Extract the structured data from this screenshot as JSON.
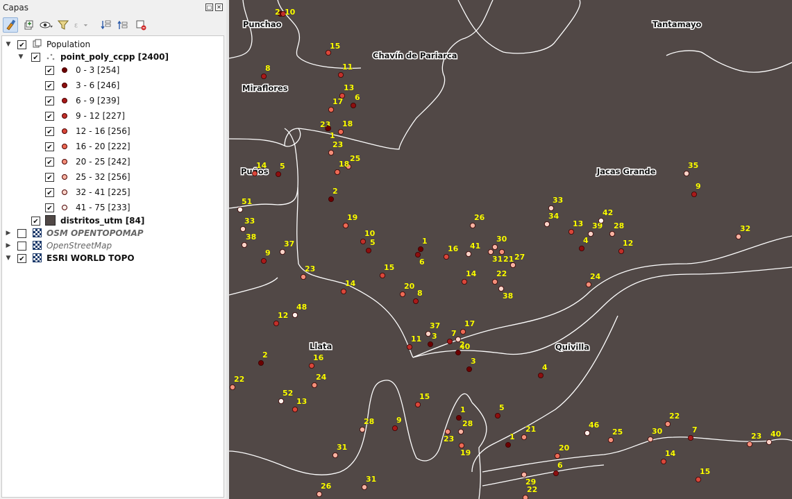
{
  "panel": {
    "title": "Capas",
    "toolbar_icons": [
      "style-manager-icon",
      "add-group-icon",
      "visibility-eye-icon",
      "filter-icon",
      "expression-filter-icon",
      "expand-all-icon",
      "collapse-all-icon",
      "remove-layer-icon"
    ]
  },
  "tree": {
    "group": {
      "label": "Population",
      "checked": true,
      "expanded": true
    },
    "points_layer": {
      "label": "point_poly_ccpp [2400]",
      "checked": true,
      "expanded": true
    },
    "classes": [
      {
        "label": "0 - 3 [254]",
        "color": "#6b0000"
      },
      {
        "label": "3 - 6 [246]",
        "color": "#8c0f0f"
      },
      {
        "label": "6 - 9 [239]",
        "color": "#a81a1a"
      },
      {
        "label": "9 - 12 [227]",
        "color": "#c0302a"
      },
      {
        "label": "12 - 16 [256]",
        "color": "#d9473a"
      },
      {
        "label": "16 - 20 [222]",
        "color": "#ec6a55"
      },
      {
        "label": "20 - 25 [242]",
        "color": "#f48f7a"
      },
      {
        "label": "25 - 32 [256]",
        "color": "#f8b3a2"
      },
      {
        "label": "32 - 41 [225]",
        "color": "#fbd3c8"
      },
      {
        "label": "41 - 75 [233]",
        "color": "#fff1ec"
      }
    ],
    "polygons_layer": {
      "label": "distritos_utm [84]",
      "checked": true,
      "color": "#514846"
    },
    "basemaps": [
      {
        "label": "OSM OPENTOPOMAP",
        "checked": false,
        "style": "italic"
      },
      {
        "label": "OpenStreetMap",
        "checked": false,
        "style": "italic"
      },
      {
        "label": "ESRI WORLD TOPO",
        "checked": true,
        "style": "bold"
      }
    ]
  },
  "map": {
    "district_labels": [
      "Punchao",
      "Tantamayo",
      "Chavín de Pariarca",
      "Miraflores",
      "Puños",
      "Jacas Grande",
      "Llata",
      "Quivilla"
    ],
    "points": [
      {
        "label": "2",
        "v": 2
      },
      {
        "label": "10",
        "v": 10
      },
      {
        "label": "15",
        "v": 15
      },
      {
        "label": "8",
        "v": 8
      },
      {
        "label": "11",
        "v": 11
      },
      {
        "label": "13",
        "v": 13
      },
      {
        "label": "6",
        "v": 6
      },
      {
        "label": "17",
        "v": 17
      },
      {
        "label": "23",
        "v": 23
      },
      {
        "label": "1",
        "v": 1
      },
      {
        "label": "18",
        "v": 18
      },
      {
        "label": "23",
        "v": 23
      },
      {
        "label": "25",
        "v": 25
      },
      {
        "label": "18",
        "v": 18
      },
      {
        "label": "14",
        "v": 14
      },
      {
        "label": "5",
        "v": 5
      },
      {
        "label": "2",
        "v": 2
      },
      {
        "label": "51",
        "v": 51
      },
      {
        "label": "33",
        "v": 33
      },
      {
        "label": "38",
        "v": 38
      },
      {
        "label": "9",
        "v": 9
      },
      {
        "label": "37",
        "v": 37
      },
      {
        "label": "19",
        "v": 19
      },
      {
        "label": "10",
        "v": 10
      },
      {
        "label": "5",
        "v": 5
      },
      {
        "label": "26",
        "v": 26
      },
      {
        "label": "1",
        "v": 1
      },
      {
        "label": "6",
        "v": 6
      },
      {
        "label": "16",
        "v": 16
      },
      {
        "label": "41",
        "v": 41
      },
      {
        "label": "30",
        "v": 30
      },
      {
        "label": "31",
        "v": 31
      },
      {
        "label": "21",
        "v": 21
      },
      {
        "label": "27",
        "v": 27
      },
      {
        "label": "33",
        "v": 33
      },
      {
        "label": "34",
        "v": 34
      },
      {
        "label": "13",
        "v": 13
      },
      {
        "label": "39",
        "v": 39
      },
      {
        "label": "42",
        "v": 42
      },
      {
        "label": "28",
        "v": 28
      },
      {
        "label": "4",
        "v": 4
      },
      {
        "label": "12",
        "v": 12
      },
      {
        "label": "35",
        "v": 35
      },
      {
        "label": "9",
        "v": 9
      },
      {
        "label": "32",
        "v": 32
      },
      {
        "label": "23",
        "v": 23
      },
      {
        "label": "15",
        "v": 15
      },
      {
        "label": "14",
        "v": 14
      },
      {
        "label": "20",
        "v": 20
      },
      {
        "label": "8",
        "v": 8
      },
      {
        "label": "14",
        "v": 14
      },
      {
        "label": "22",
        "v": 22
      },
      {
        "label": "38",
        "v": 38
      },
      {
        "label": "24",
        "v": 24
      },
      {
        "label": "12",
        "v": 12
      },
      {
        "label": "48",
        "v": 48
      },
      {
        "label": "37",
        "v": 37
      },
      {
        "label": "17",
        "v": 17
      },
      {
        "label": "7",
        "v": 7
      },
      {
        "label": "40",
        "v": 40
      },
      {
        "label": "11",
        "v": 11
      },
      {
        "label": "3",
        "v": 3
      },
      {
        "label": "2",
        "v": 2
      },
      {
        "label": "2",
        "v": 2
      },
      {
        "label": "16",
        "v": 16
      },
      {
        "label": "3",
        "v": 3
      },
      {
        "label": "4",
        "v": 4
      },
      {
        "label": "22",
        "v": 22
      },
      {
        "label": "24",
        "v": 24
      },
      {
        "label": "52",
        "v": 52
      },
      {
        "label": "13",
        "v": 13
      },
      {
        "label": "15",
        "v": 15
      },
      {
        "label": "1",
        "v": 1
      },
      {
        "label": "5",
        "v": 5
      },
      {
        "label": "28",
        "v": 28
      },
      {
        "label": "9",
        "v": 9
      },
      {
        "label": "23",
        "v": 23
      },
      {
        "label": "28",
        "v": 28
      },
      {
        "label": "19",
        "v": 19
      },
      {
        "label": "1",
        "v": 1
      },
      {
        "label": "21",
        "v": 21
      },
      {
        "label": "46",
        "v": 46
      },
      {
        "label": "25",
        "v": 25
      },
      {
        "label": "30",
        "v": 30
      },
      {
        "label": "22",
        "v": 22
      },
      {
        "label": "7",
        "v": 7
      },
      {
        "label": "23",
        "v": 23
      },
      {
        "label": "40",
        "v": 40
      },
      {
        "label": "31",
        "v": 31
      },
      {
        "label": "20",
        "v": 20
      },
      {
        "label": "14",
        "v": 14
      },
      {
        "label": "29",
        "v": 29
      },
      {
        "label": "6",
        "v": 6
      },
      {
        "label": "15",
        "v": 15
      },
      {
        "label": "26",
        "v": 26
      },
      {
        "label": "31",
        "v": 31
      },
      {
        "label": "22",
        "v": 22
      }
    ]
  }
}
